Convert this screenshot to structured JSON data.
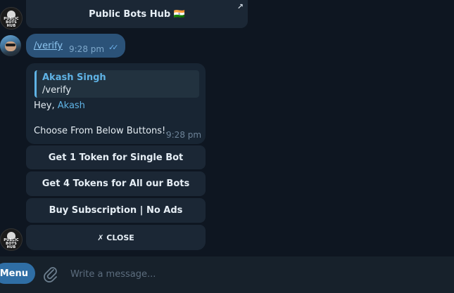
{
  "top_bubble": {
    "text": "Public Bots Hub 🇮🇳",
    "arrow": "↗"
  },
  "user_message": {
    "text": "/verify",
    "time": "9:28 pm",
    "status_icon": "double-check-icon",
    "check_mark": "✓✓"
  },
  "bot_reply": {
    "quote_author": "Akash Singh",
    "quote_text": "/verify",
    "greeting": "Hey,",
    "name": "Akash",
    "body": "Choose From Below Buttons!.",
    "time": "9:28 pm"
  },
  "avatars": {
    "bot_text_line1": "PUBLIC",
    "bot_text_line2": "BOTS HUB"
  },
  "inline_buttons": [
    {
      "label": "Get 1 Token for Single Bot"
    },
    {
      "label": "Get 4 Tokens for All our Bots"
    },
    {
      "label": "Buy Subscription | No Ads"
    },
    {
      "label": "✗ CLOSE"
    }
  ],
  "composer": {
    "menu_label": "Menu",
    "placeholder": "Write a message..."
  },
  "colors": {
    "background": "#0e1621",
    "bubble": "#182533",
    "user_bubble": "#2b5278",
    "accent": "#5fb3e5",
    "menu_button": "#2f6ea5"
  }
}
